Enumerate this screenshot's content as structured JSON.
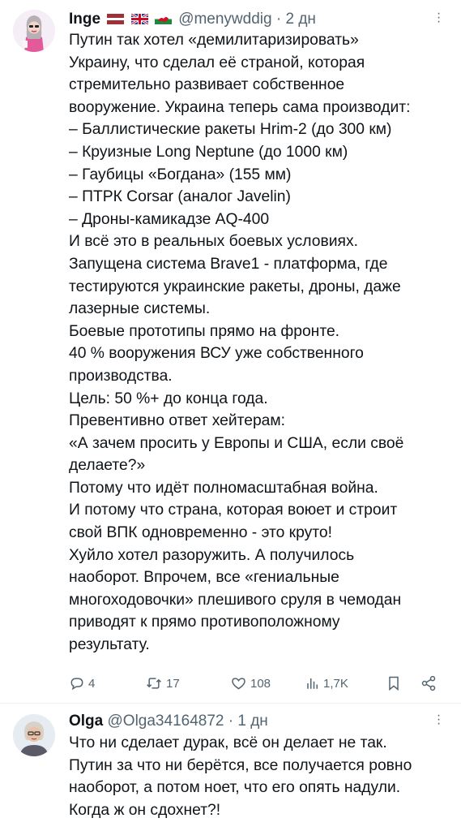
{
  "tweets": [
    {
      "author_name": "Inge",
      "handle": "@menywddig",
      "time": "2 дн",
      "lines": [
        "Путин так хотел «демилитаризировать»",
        "Украину, что сделал её страной, которая",
        "стремительно развивает собственное",
        "вооружение. Украина теперь сама производит:",
        "– Баллистические ракеты Hrim-2 (до 300 км)",
        "– Круизные Long Neptune (до 1000 км)",
        "– Гаубицы «Богдана» (155 мм)",
        "– ПТРК Corsar (аналог Javelin)",
        "– Дроны-камикадзе AQ-400",
        "И всё это в реальных боевых условиях.",
        "Запущена система Brave1 - платформа, где",
        "тестируются украинские ракеты, дроны, даже",
        "лазерные системы.",
        "Боевые прототипы прямо на фронте.",
        "40 % вооружения ВСУ уже собственного",
        "производства.",
        "Цель: 50 %+ до конца года.",
        "Превентивно ответ хейтерам:",
        "«А зачем просить у Европы и США, если своё",
        "делаете?»",
        "Потому что идёт полномасштабная война.",
        "И потому что страна, которая воюет и строит",
        "свой ВПК одновременно - это круто!",
        "Хуйло хотел разоружить. А получилось",
        "наоборот. Впрочем, все «гениальные",
        "многоходовочки» плешивого сруля в чемодан",
        "приводят к прямо противоположному",
        "результату."
      ],
      "actions": {
        "replies": "4",
        "retweets": "17",
        "likes": "108",
        "views": "1,7K"
      }
    },
    {
      "author_name": "Olga",
      "handle": "@Olga34164872",
      "time": "1 дн",
      "lines": [
        "Что ни сделает дурак, всё он делает не так.",
        "Путин за что ни берётся, все получается ровно",
        "наоборот, а потом ноет, что его опять надули.",
        "Когда ж он сдохнет?!"
      ]
    }
  ],
  "separator": "·",
  "icons": {
    "reply": "reply-icon",
    "retweet": "retweet-icon",
    "like": "heart-icon",
    "views": "views-icon",
    "bookmark": "bookmark-icon",
    "share": "share-icon",
    "more": "more-icon"
  }
}
